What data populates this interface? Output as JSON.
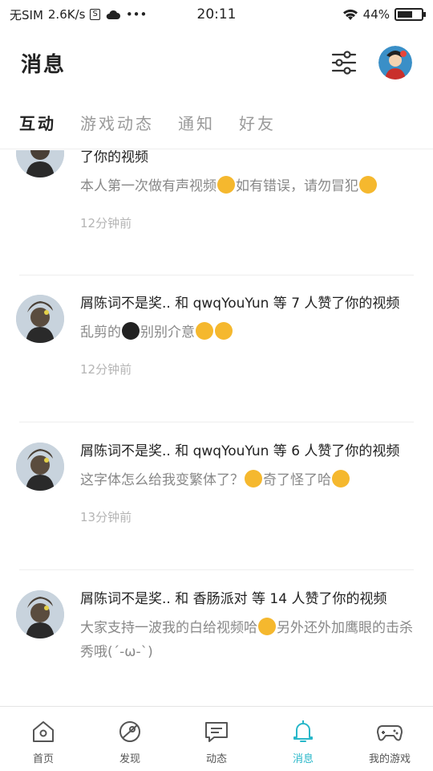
{
  "status_bar": {
    "carrier": "无SIM",
    "speed": "2.6K/s",
    "sim_icon_text": "S",
    "more": "•••",
    "time": "20:11",
    "battery": "44%"
  },
  "header": {
    "title": "消息"
  },
  "tabs": [
    {
      "label": "互动",
      "active": true
    },
    {
      "label": "游戏动态",
      "active": false
    },
    {
      "label": "通知",
      "active": false
    },
    {
      "label": "好友",
      "active": false
    }
  ],
  "feed": [
    {
      "title": "了你的视频",
      "body_before": "本人第一次做有声视频",
      "body_middle": "如有错误，请勿冒犯",
      "body_after": "",
      "time": "12分钟前"
    },
    {
      "title": "屑陈词不是奖.. 和 qwqYouYun 等 7 人赞了你的视频",
      "body_before": "乱剪的",
      "body_middle": "别别介意",
      "body_after": "",
      "time": "12分钟前"
    },
    {
      "title": "屑陈词不是奖.. 和 qwqYouYun 等 6 人赞了你的视频",
      "body_before": "这字体怎么给我变繁体了？",
      "body_middle": "奇了怪了哈",
      "body_after": "",
      "time": "13分钟前"
    },
    {
      "title": "屑陈词不是奖.. 和 香肠派对 等 14 人赞了你的视频",
      "body_before": "大家支持一波我的白给视频哈",
      "body_middle": "另外还外加鹰眼的击杀秀哦(´-ω-`)",
      "body_after": "",
      "time": ""
    }
  ],
  "bottom_nav": [
    {
      "label": "首页",
      "icon": "home-icon",
      "active": false
    },
    {
      "label": "发现",
      "icon": "discover-icon",
      "active": false
    },
    {
      "label": "动态",
      "icon": "feed-icon",
      "active": false
    },
    {
      "label": "消息",
      "icon": "bell-icon",
      "active": true
    },
    {
      "label": "我的游戏",
      "icon": "gamepad-icon",
      "active": false
    }
  ],
  "colors": {
    "accent": "#28b7c9",
    "text": "#222222",
    "muted": "#888888",
    "time": "#b5b5b5"
  }
}
